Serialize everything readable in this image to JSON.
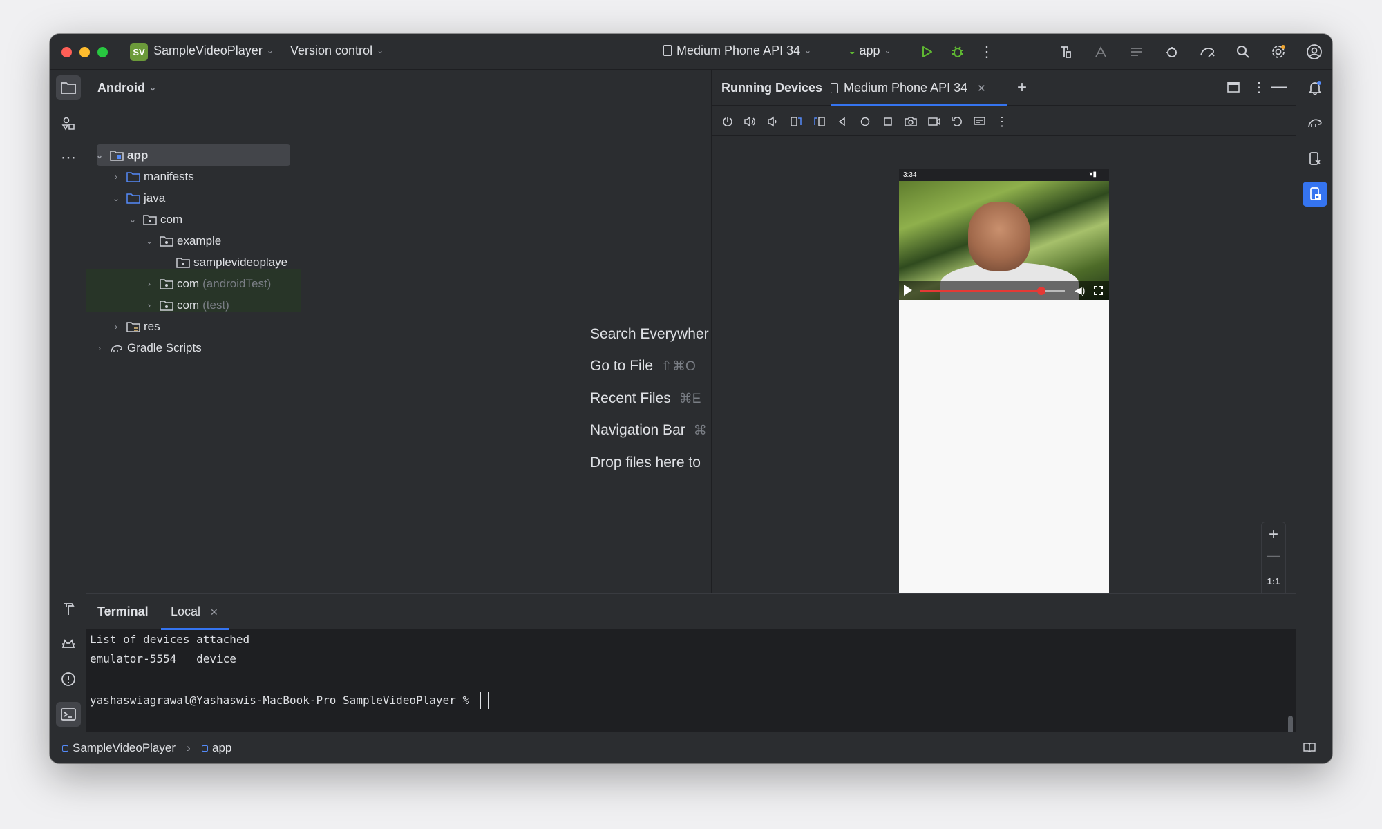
{
  "titlebar": {
    "project_badge": "SV",
    "project_name": "SampleVideoPlayer",
    "version_control": "Version control",
    "device": "Medium Phone API 34",
    "run_config": "app"
  },
  "project_panel": {
    "view": "Android",
    "tree": {
      "app": "app",
      "manifests": "manifests",
      "java": "java",
      "com": "com",
      "example": "example",
      "package": "samplevideoplaye",
      "com_android_test": "com",
      "android_test_suffix": "(androidTest)",
      "com_test": "com",
      "test_suffix": "(test)",
      "res": "res",
      "gradle": "Gradle Scripts"
    }
  },
  "editor": {
    "hints": [
      {
        "label": "Search Everywher",
        "shortcut": ""
      },
      {
        "label": "Go to File",
        "shortcut": "⇧⌘O"
      },
      {
        "label": "Recent Files",
        "shortcut": "⌘E"
      },
      {
        "label": "Navigation Bar",
        "shortcut": "⌘"
      },
      {
        "label": "Drop files here to",
        "shortcut": ""
      }
    ]
  },
  "devices": {
    "title": "Running Devices",
    "tab": "Medium Phone API 34",
    "phone_time": "3:34",
    "video_progress": 0.84,
    "zoom_label": "1:1"
  },
  "terminal": {
    "title": "Terminal",
    "tab": "Local",
    "lines": [
      "List of devices attached",
      "emulator-5554   device",
      "",
      "yashaswiagrawal@Yashaswis-MacBook-Pro SampleVideoPlayer % "
    ]
  },
  "statusbar": {
    "crumb_project": "SampleVideoPlayer",
    "crumb_module": "app"
  },
  "colors": {
    "accent": "#3574f0",
    "background": "#2b2d30",
    "terminal_bg": "#1e1f22",
    "test_highlight": "#283528",
    "run_green": "#5fb832"
  }
}
